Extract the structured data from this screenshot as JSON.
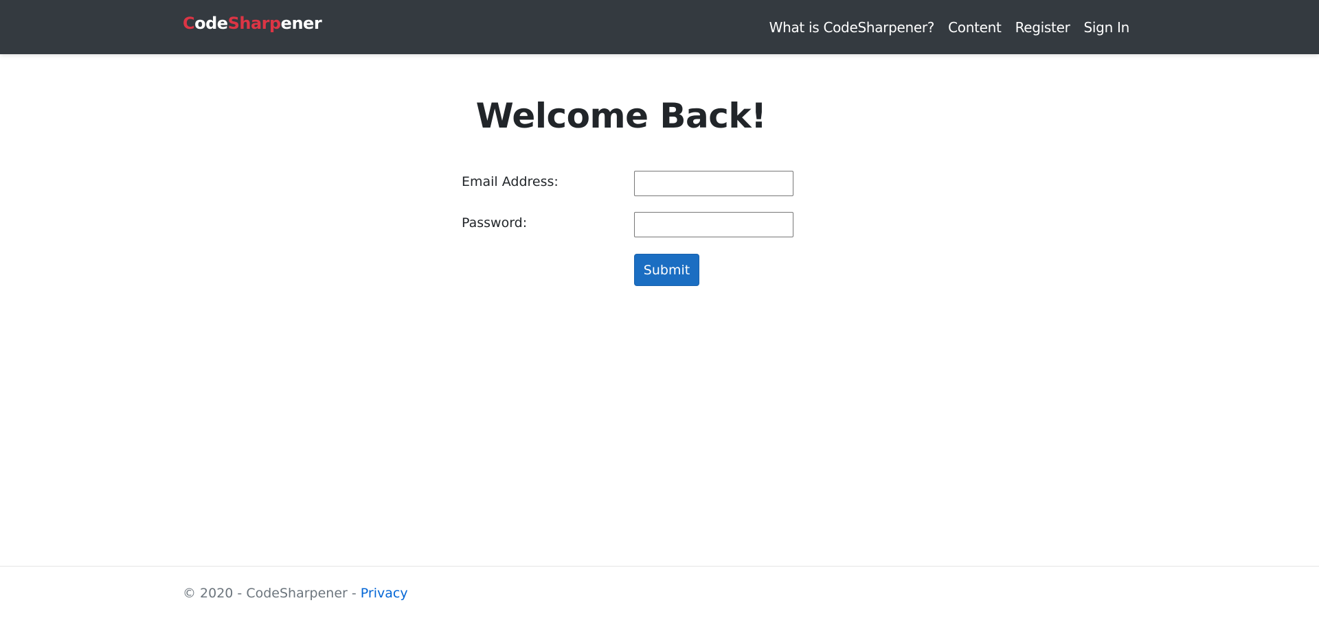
{
  "header": {
    "brand": [
      {
        "text": "C",
        "color": "red"
      },
      {
        "text": "ode",
        "color": "white"
      },
      {
        "text": "Sharp",
        "color": "red"
      },
      {
        "text": "ener",
        "color": "white"
      }
    ],
    "nav": [
      {
        "label": "What is CodeSharpener?"
      },
      {
        "label": "Content"
      },
      {
        "label": "Register"
      },
      {
        "label": "Sign In"
      }
    ]
  },
  "main": {
    "title": "Welcome Back!",
    "form": {
      "email_label": "Email Address:",
      "email_value": "",
      "password_label": "Password:",
      "password_value": "",
      "submit_label": "Submit"
    }
  },
  "footer": {
    "copyright": "© 2020 - CodeSharpener - ",
    "privacy_link": "Privacy"
  },
  "colors": {
    "navbar_bg": "#343a40",
    "brand_accent": "#dc3545",
    "primary_button": "#1b6ec2",
    "link": "#0366d6"
  }
}
